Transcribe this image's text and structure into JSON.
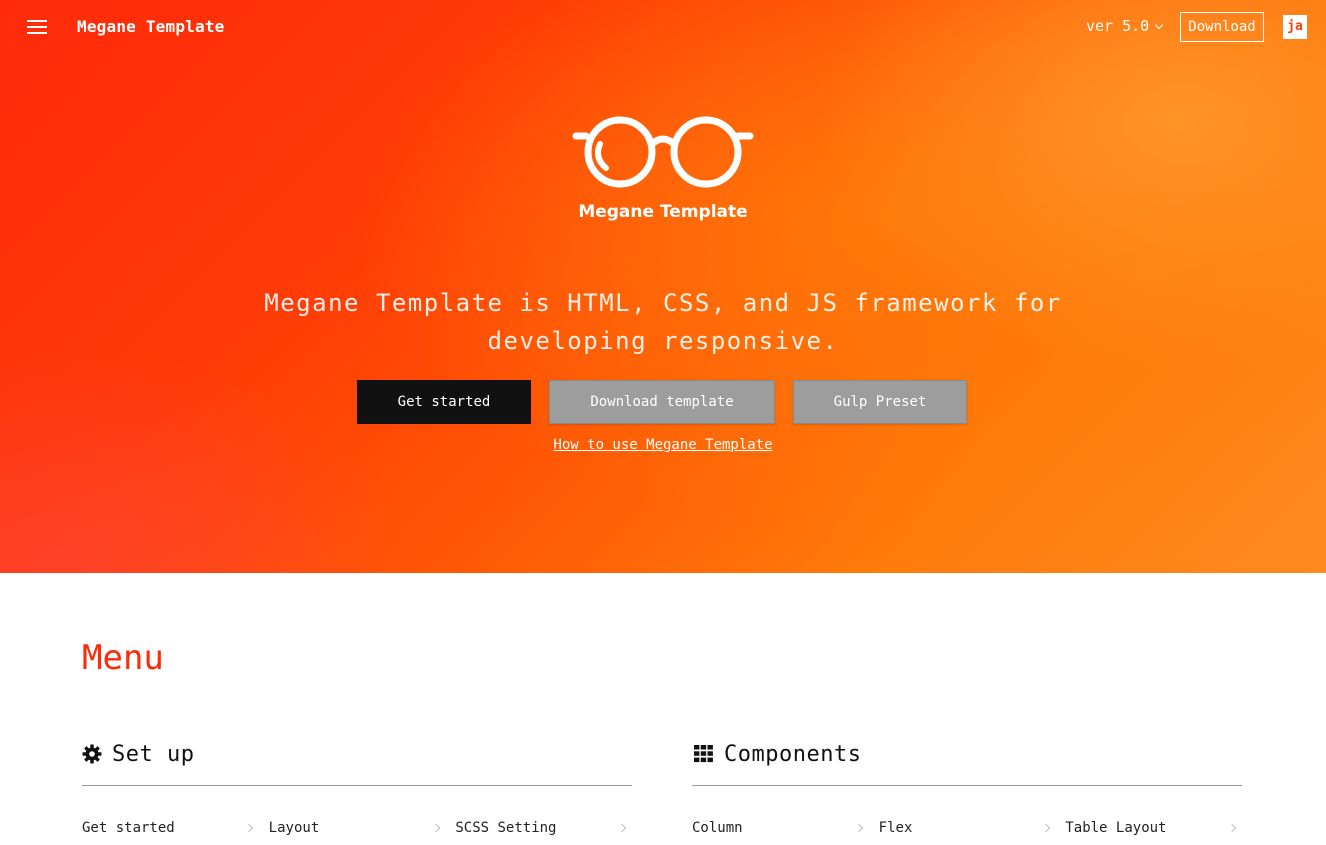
{
  "header": {
    "brand": "Megane Template",
    "version_label": "ver 5.0",
    "download_label": "Download",
    "lang_label": "ja"
  },
  "hero": {
    "logo_text": "Megane Template",
    "tagline": "Megane Template is HTML, CSS, and JS framework for developing responsive.",
    "buttons": {
      "get_started": "Get started",
      "download_template": "Download template",
      "gulp_preset": "Gulp Preset"
    },
    "howto_link": "How to use Megane Template"
  },
  "menu": {
    "title": "Menu",
    "categories": [
      {
        "icon": "gear-icon",
        "title": "Set up",
        "items": [
          "Get started",
          "Layout",
          "SCSS Setting"
        ]
      },
      {
        "icon": "grid-icon",
        "title": "Components",
        "items": [
          "Column",
          "Flex",
          "Table Layout"
        ]
      }
    ]
  },
  "colors": {
    "accent": "#ff2a0a",
    "hero_orange": "#ff7a0a",
    "dark_button": "#111111",
    "gray_button": "#9d9d9d"
  }
}
